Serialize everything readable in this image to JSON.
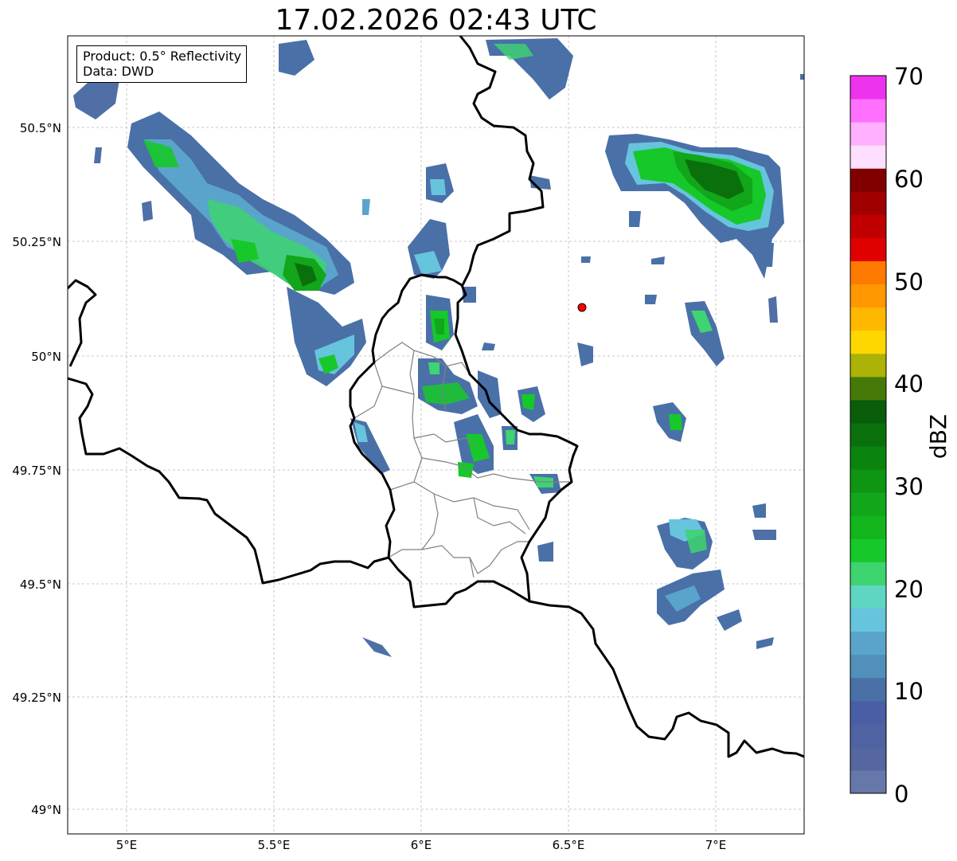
{
  "title": "17.02.2026 02:43 UTC",
  "info_box": {
    "product": "Product: 0.5° Reflectivity",
    "source": "Data: DWD"
  },
  "map": {
    "lon_labels": [
      "5°E",
      "5.5°E",
      "6°E",
      "6.5°E",
      "7°E"
    ],
    "lat_labels": [
      "50.5°N",
      "50.25°N",
      "50°N",
      "49.75°N",
      "49.5°N",
      "49.25°N",
      "49°N"
    ],
    "gridlines": "dashed",
    "radar_site_color": "#ff0000"
  },
  "colorbar": {
    "label": "dBZ",
    "tick_labels": [
      "0",
      "10",
      "20",
      "30",
      "40",
      "50",
      "60",
      "70"
    ],
    "colors": [
      "#6677aa",
      "#5566a0",
      "#4f62a2",
      "#4a5ea6",
      "#4a70a8",
      "#5090bb",
      "#5aa4cc",
      "#66c4dd",
      "#5fd6c2",
      "#3ed46f",
      "#16c82a",
      "#12b61c",
      "#12a61a",
      "#0e9514",
      "#0b830f",
      "#0a700c",
      "#0a5d0a",
      "#467a08",
      "#acb206",
      "#ffd700",
      "#ffb800",
      "#ff9800",
      "#ff7a00",
      "#e00000",
      "#c00000",
      "#a00000",
      "#800000",
      "#ffdfff",
      "#ffb0ff",
      "#ff70ff",
      "#ee33ee"
    ]
  }
}
